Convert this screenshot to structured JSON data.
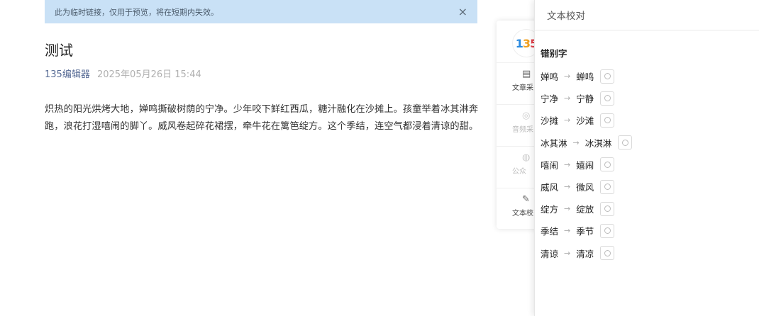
{
  "notice": {
    "text": "此为临时链接，仅用于预览，将在短期内失效。",
    "close_icon": "×"
  },
  "article": {
    "title": "测试",
    "author": "135编辑器",
    "date": "2025年05月26日 15:44",
    "body": "炽热的阳光烘烤大地，婵鸣撕破树荫的宁净。少年咬下鲜红西瓜，糖汁融化在沙摊上。孩童举着冰其淋奔跑，浪花打湿嘻闹的脚丫。威风卷起碎花裙摆，牵牛花在篱笆绽方。这个季结，连空气都浸着清谅的甜。"
  },
  "toolpanel": {
    "logo": {
      "d1": "1",
      "d2": "3",
      "d3": "5"
    },
    "tools": [
      {
        "label": "文章采",
        "icon": "document-icon",
        "glyph": "▤",
        "dim": false
      },
      {
        "label": "音频采",
        "icon": "audio-icon",
        "glyph": "◎",
        "dim": true
      },
      {
        "label": "公众",
        "icon": "wechat-icon",
        "glyph": "◍",
        "dim": true
      },
      {
        "label": "文本校",
        "icon": "proofread-icon",
        "glyph": "✎",
        "dim": false
      }
    ]
  },
  "proof": {
    "header": "文本校对",
    "section_title": "错别字",
    "arrow": "→",
    "items": [
      {
        "wrong": "婵鸣",
        "right": "蝉鸣"
      },
      {
        "wrong": "宁净",
        "right": "宁静"
      },
      {
        "wrong": "沙摊",
        "right": "沙滩"
      },
      {
        "wrong": "冰其淋",
        "right": "冰淇淋"
      },
      {
        "wrong": "嘻闹",
        "right": "嬉闹"
      },
      {
        "wrong": "威风",
        "right": "微风"
      },
      {
        "wrong": "绽方",
        "right": "绽放"
      },
      {
        "wrong": "季结",
        "right": "季节"
      },
      {
        "wrong": "清谅",
        "right": "清凉"
      }
    ]
  }
}
